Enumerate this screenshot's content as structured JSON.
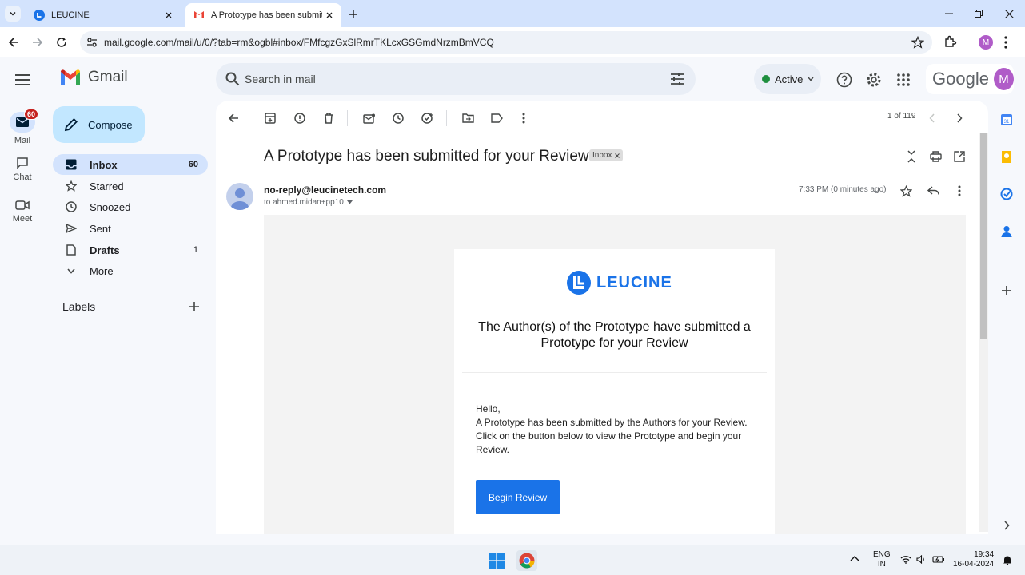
{
  "browser": {
    "tabs": [
      {
        "title": "LEUCINE",
        "active": false
      },
      {
        "title": "A Prototype has been submitte",
        "active": true
      }
    ],
    "url": "mail.google.com/mail/u/0/?tab=rm&ogbl#inbox/FMfcgzGxSlRmrTKLcxGSGmdNrzmBmVCQ",
    "profile_initial": "M"
  },
  "gmail": {
    "app_name": "Gmail",
    "search_placeholder": "Search in mail",
    "status": "Active",
    "google_word": "Google",
    "avatar_initial": "M",
    "rail": {
      "mail_label": "Mail",
      "mail_badge": "60",
      "chat_label": "Chat",
      "meet_label": "Meet"
    },
    "compose_label": "Compose",
    "nav": [
      {
        "label": "Inbox",
        "count": "60"
      },
      {
        "label": "Starred",
        "count": ""
      },
      {
        "label": "Snoozed",
        "count": ""
      },
      {
        "label": "Sent",
        "count": ""
      },
      {
        "label": "Drafts",
        "count": "1"
      },
      {
        "label": "More",
        "count": ""
      }
    ],
    "labels_heading": "Labels"
  },
  "message": {
    "pager": "1 of 119",
    "subject": "A Prototype has been submitted for your Review",
    "chip": "Inbox",
    "sender": "no-reply@leucinetech.com",
    "to": "to ahmed.midan+pp10",
    "time": "7:33 PM (0 minutes ago)",
    "brand": "LEUCINE",
    "headline": "The Author(s) of the Prototype have submitted a Prototype for your Review",
    "greeting": "Hello,",
    "body": "A Prototype has been submitted by the Authors for your Review. Click on the button below to view the Prototype and begin your Review.",
    "button": "Begin Review"
  },
  "taskbar": {
    "lang_top": "ENG",
    "lang_bottom": "IN",
    "time": "19:34",
    "date": "16-04-2024"
  }
}
